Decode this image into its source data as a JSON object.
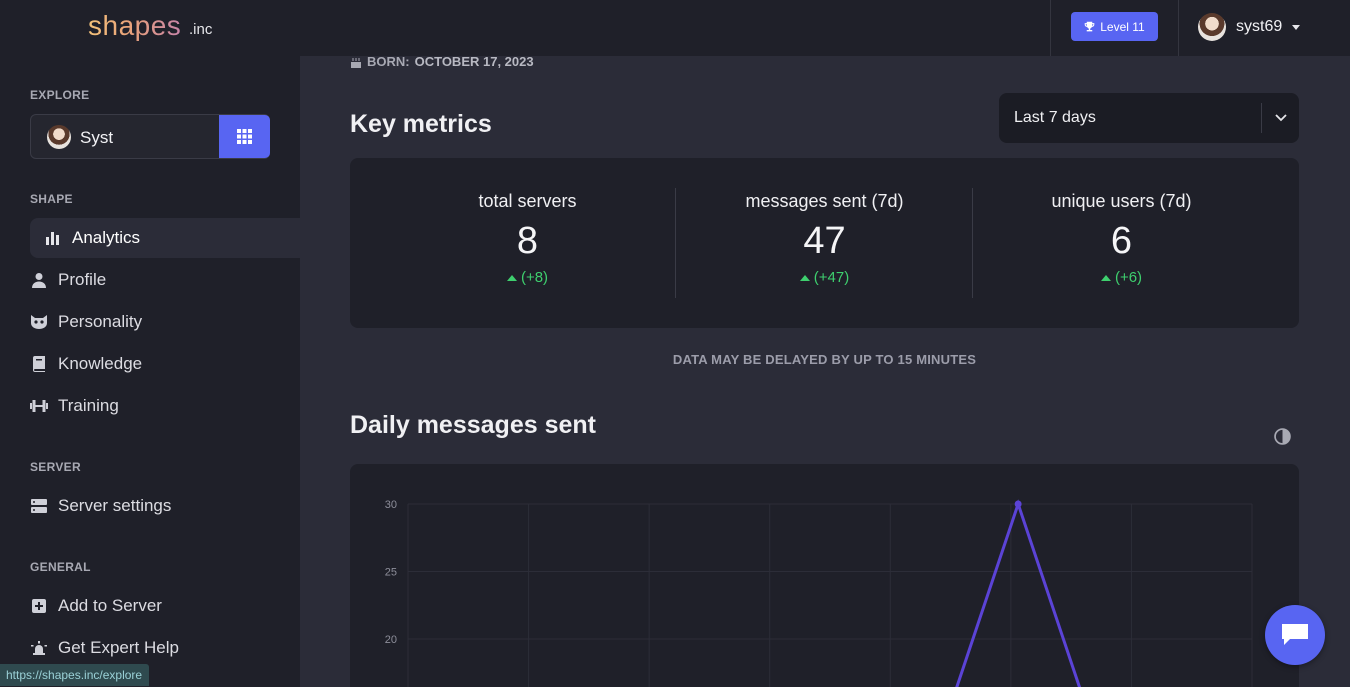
{
  "header": {
    "logo": "shapes",
    "logo_suffix": ".inc",
    "level_label": "Level 11",
    "username": "syst69"
  },
  "sidebar": {
    "explore_title": "EXPLORE",
    "explore_shape_name": "Syst",
    "shape_title": "SHAPE",
    "shape_items": [
      {
        "label": "Analytics",
        "icon": "bar-chart-icon"
      },
      {
        "label": "Profile",
        "icon": "user-icon"
      },
      {
        "label": "Personality",
        "icon": "mask-icon"
      },
      {
        "label": "Knowledge",
        "icon": "book-icon"
      },
      {
        "label": "Training",
        "icon": "dumbbell-icon"
      }
    ],
    "server_title": "SERVER",
    "server_items": [
      {
        "label": "Server settings",
        "icon": "server-icon"
      }
    ],
    "general_title": "GENERAL",
    "general_items": [
      {
        "label": "Add to Server",
        "icon": "plus-square-icon"
      },
      {
        "label": "Get Expert Help",
        "icon": "siren-icon"
      }
    ]
  },
  "main": {
    "born_label": "BORN:",
    "born_date": "OCTOBER 17, 2023",
    "key_metrics_title": "Key metrics",
    "range_selected": "Last 7 days",
    "metrics": [
      {
        "label": "total servers",
        "value": "8",
        "delta": "(+8)"
      },
      {
        "label": "messages sent (7d)",
        "value": "47",
        "delta": "(+47)"
      },
      {
        "label": "unique users (7d)",
        "value": "6",
        "delta": "(+6)"
      }
    ],
    "delay_note": "DATA MAY BE DELAYED BY UP TO 15 MINUTES",
    "daily_title": "Daily messages sent"
  },
  "status_bar": {
    "url": "https://shapes.inc/explore"
  },
  "colors": {
    "accent": "#5865f2",
    "positive": "#3ecf6e",
    "line": "#5b43d6"
  },
  "chart_data": {
    "type": "line",
    "y_ticks": [
      "30",
      "25",
      "20"
    ],
    "ylim_visible": [
      18,
      30
    ],
    "x_count": 7,
    "values": [
      null,
      null,
      null,
      null,
      null,
      30,
      null
    ],
    "peak_index": 5
  }
}
